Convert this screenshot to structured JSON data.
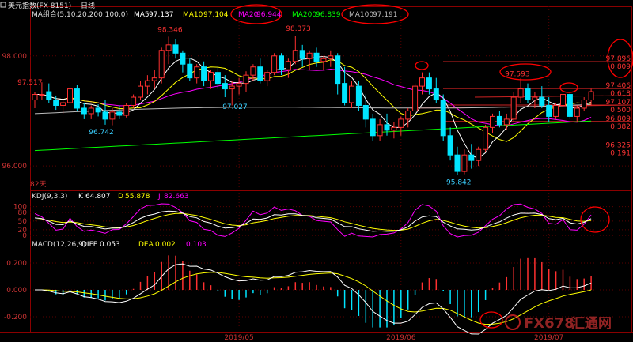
{
  "header": {
    "title": "美元指数(FX 8151)",
    "period": "日线",
    "ma_label": "MA组合(5,10,20,200,100,0)",
    "ma5_label": "MA5",
    "ma5_value": "97.137",
    "ma10_label": "MA10",
    "ma10_value": "97.104",
    "ma20_label": "MA20",
    "ma20_value": "96.944",
    "ma200_label": "MA200",
    "ma200_value": "96.839",
    "ma100_label": "MA100",
    "ma100_value": "97.191"
  },
  "colors": {
    "up": "#ff3030",
    "down": "#00e5ff",
    "ma5": "#ffffff",
    "ma10": "#ffff00",
    "ma20": "#ff00ff",
    "ma200": "#00ff00",
    "ma100": "#bbbbbb",
    "annotation": "#ff0000"
  },
  "kdj": {
    "label": "KDJ(9,3,3)",
    "k_label": "K",
    "k_value": "64.807",
    "d_label": "D",
    "d_value": "55.878",
    "j_label": "J",
    "j_value": "82.663"
  },
  "macd": {
    "label": "MACD(12,26,9)",
    "diff_label": "DIFF",
    "diff_value": "0.053",
    "dea_label": "DEA",
    "dea_value": "0.002",
    "macd_value": "0.103"
  },
  "watermark": {
    "logo_text": "FX678",
    "logo_cn": "汇通网"
  },
  "chart_data": {
    "type": "candlestick",
    "price_axis": {
      "ticks": [
        "98.000",
        "96.000"
      ],
      "ylim": [
        95.6,
        98.7
      ]
    },
    "kdj_axis": {
      "ticks": [
        "100",
        "80",
        "50",
        "20",
        "0"
      ],
      "ylim": [
        -5,
        110
      ]
    },
    "macd_axis": {
      "ticks": [
        "0.200",
        "0.000",
        "-0.200"
      ],
      "ylim": [
        -0.3,
        0.3
      ]
    },
    "x_ticks": [
      {
        "label": "2019/05",
        "index": 29
      },
      {
        "label": "2019/06",
        "index": 52
      },
      {
        "label": "2019/07",
        "index": 73
      }
    ],
    "price_labels": [
      "97.517",
      "98.346",
      "98.373",
      "97.027",
      "96.742",
      "95.842",
      "97.593",
      "82天"
    ],
    "fib_levels": [
      {
        "price": 97.896,
        "right_label": "97.896",
        "pct": "0.809"
      },
      {
        "price": 97.406,
        "right_label": "97.406",
        "pct": "0.618"
      },
      {
        "price": 97.107,
        "right_label": "97.107",
        "pct": "0.500"
      },
      {
        "price": 96.809,
        "right_label": "96.809",
        "pct": "0.382"
      },
      {
        "price": 96.325,
        "right_label": "96.325",
        "pct": "0.191"
      }
    ],
    "candles": [
      [
        97.2,
        97.35,
        97.05,
        97.3
      ],
      [
        97.3,
        97.52,
        97.2,
        97.3
      ],
      [
        97.35,
        97.5,
        97.15,
        97.2
      ],
      [
        97.2,
        97.28,
        97.02,
        97.1
      ],
      [
        97.1,
        97.2,
        96.95,
        97.15
      ],
      [
        97.15,
        97.45,
        97.1,
        97.4
      ],
      [
        97.4,
        97.48,
        97.0,
        97.05
      ],
      [
        97.05,
        97.15,
        96.85,
        96.95
      ],
      [
        96.95,
        97.1,
        96.85,
        97.05
      ],
      [
        97.05,
        97.12,
        96.9,
        96.98
      ],
      [
        96.98,
        97.2,
        96.75,
        96.85
      ],
      [
        96.85,
        97.05,
        96.74,
        96.98
      ],
      [
        96.98,
        97.1,
        96.85,
        96.92
      ],
      [
        96.92,
        97.15,
        96.88,
        97.1
      ],
      [
        97.1,
        97.3,
        97.05,
        97.25
      ],
      [
        97.25,
        97.55,
        97.2,
        97.45
      ],
      [
        97.45,
        97.65,
        97.3,
        97.55
      ],
      [
        97.55,
        97.75,
        97.4,
        97.6
      ],
      [
        97.6,
        98.15,
        97.5,
        98.1
      ],
      [
        98.1,
        98.35,
        97.85,
        98.2
      ],
      [
        98.2,
        98.3,
        97.95,
        98.05
      ],
      [
        98.05,
        98.1,
        97.7,
        97.85
      ],
      [
        97.85,
        97.95,
        97.55,
        97.6
      ],
      [
        97.6,
        97.85,
        97.5,
        97.8
      ],
      [
        97.8,
        97.9,
        97.45,
        97.55
      ],
      [
        97.55,
        97.75,
        97.4,
        97.7
      ],
      [
        97.7,
        97.8,
        97.4,
        97.5
      ],
      [
        97.5,
        97.65,
        97.25,
        97.4
      ],
      [
        97.4,
        97.55,
        97.1,
        97.45
      ],
      [
        97.45,
        97.6,
        97.3,
        97.5
      ],
      [
        97.5,
        97.72,
        97.35,
        97.65
      ],
      [
        97.65,
        97.85,
        97.55,
        97.8
      ],
      [
        97.8,
        97.95,
        97.5,
        97.55
      ],
      [
        97.55,
        97.75,
        97.45,
        97.7
      ],
      [
        97.7,
        98.05,
        97.65,
        98.0
      ],
      [
        98.0,
        98.05,
        97.65,
        97.75
      ],
      [
        97.75,
        97.95,
        97.6,
        97.9
      ],
      [
        97.9,
        98.37,
        97.85,
        98.1
      ],
      [
        98.1,
        98.2,
        97.8,
        97.95
      ],
      [
        97.95,
        98.1,
        97.75,
        98.05
      ],
      [
        98.05,
        98.15,
        97.8,
        97.9
      ],
      [
        97.9,
        98.0,
        97.75,
        97.95
      ],
      [
        97.95,
        98.1,
        97.8,
        98.0
      ],
      [
        98.0,
        98.05,
        97.3,
        97.5
      ],
      [
        97.5,
        97.8,
        97.1,
        97.15
      ],
      [
        97.15,
        97.55,
        97.05,
        97.45
      ],
      [
        97.45,
        97.55,
        97.0,
        97.1
      ],
      [
        97.1,
        97.3,
        96.7,
        96.85
      ],
      [
        96.85,
        96.95,
        96.45,
        96.55
      ],
      [
        96.55,
        96.85,
        96.45,
        96.75
      ],
      [
        96.75,
        96.95,
        96.55,
        96.65
      ],
      [
        96.65,
        96.8,
        96.5,
        96.7
      ],
      [
        96.7,
        96.9,
        96.55,
        96.85
      ],
      [
        96.85,
        97.05,
        96.7,
        97.0
      ],
      [
        97.0,
        97.5,
        96.95,
        97.45
      ],
      [
        97.45,
        97.7,
        97.3,
        97.6
      ],
      [
        97.6,
        97.7,
        97.3,
        97.4
      ],
      [
        97.4,
        97.6,
        97.15,
        97.2
      ],
      [
        97.2,
        97.3,
        96.45,
        96.55
      ],
      [
        96.55,
        96.7,
        96.1,
        96.2
      ],
      [
        96.2,
        96.35,
        95.84,
        95.9
      ],
      [
        95.9,
        96.3,
        95.85,
        96.2
      ],
      [
        96.2,
        96.4,
        95.95,
        96.1
      ],
      [
        96.1,
        96.35,
        96.0,
        96.3
      ],
      [
        96.3,
        96.75,
        96.25,
        96.7
      ],
      [
        96.7,
        96.95,
        96.6,
        96.9
      ],
      [
        96.9,
        97.0,
        96.7,
        96.75
      ],
      [
        96.75,
        96.95,
        96.65,
        96.85
      ],
      [
        96.85,
        97.35,
        96.8,
        97.25
      ],
      [
        97.25,
        97.59,
        97.15,
        97.4
      ],
      [
        97.4,
        97.5,
        97.15,
        97.2
      ],
      [
        97.2,
        97.35,
        97.05,
        97.25
      ],
      [
        97.25,
        97.45,
        97.05,
        97.1
      ],
      [
        97.1,
        97.25,
        96.8,
        96.9
      ],
      [
        96.9,
        97.15,
        96.85,
        97.1
      ],
      [
        97.1,
        97.35,
        97.05,
        97.3
      ],
      [
        97.3,
        97.35,
        96.85,
        96.9
      ],
      [
        96.9,
        97.1,
        96.8,
        97.05
      ],
      [
        97.05,
        97.25,
        97.0,
        97.2
      ],
      [
        97.2,
        97.4,
        97.1,
        97.35
      ]
    ]
  }
}
